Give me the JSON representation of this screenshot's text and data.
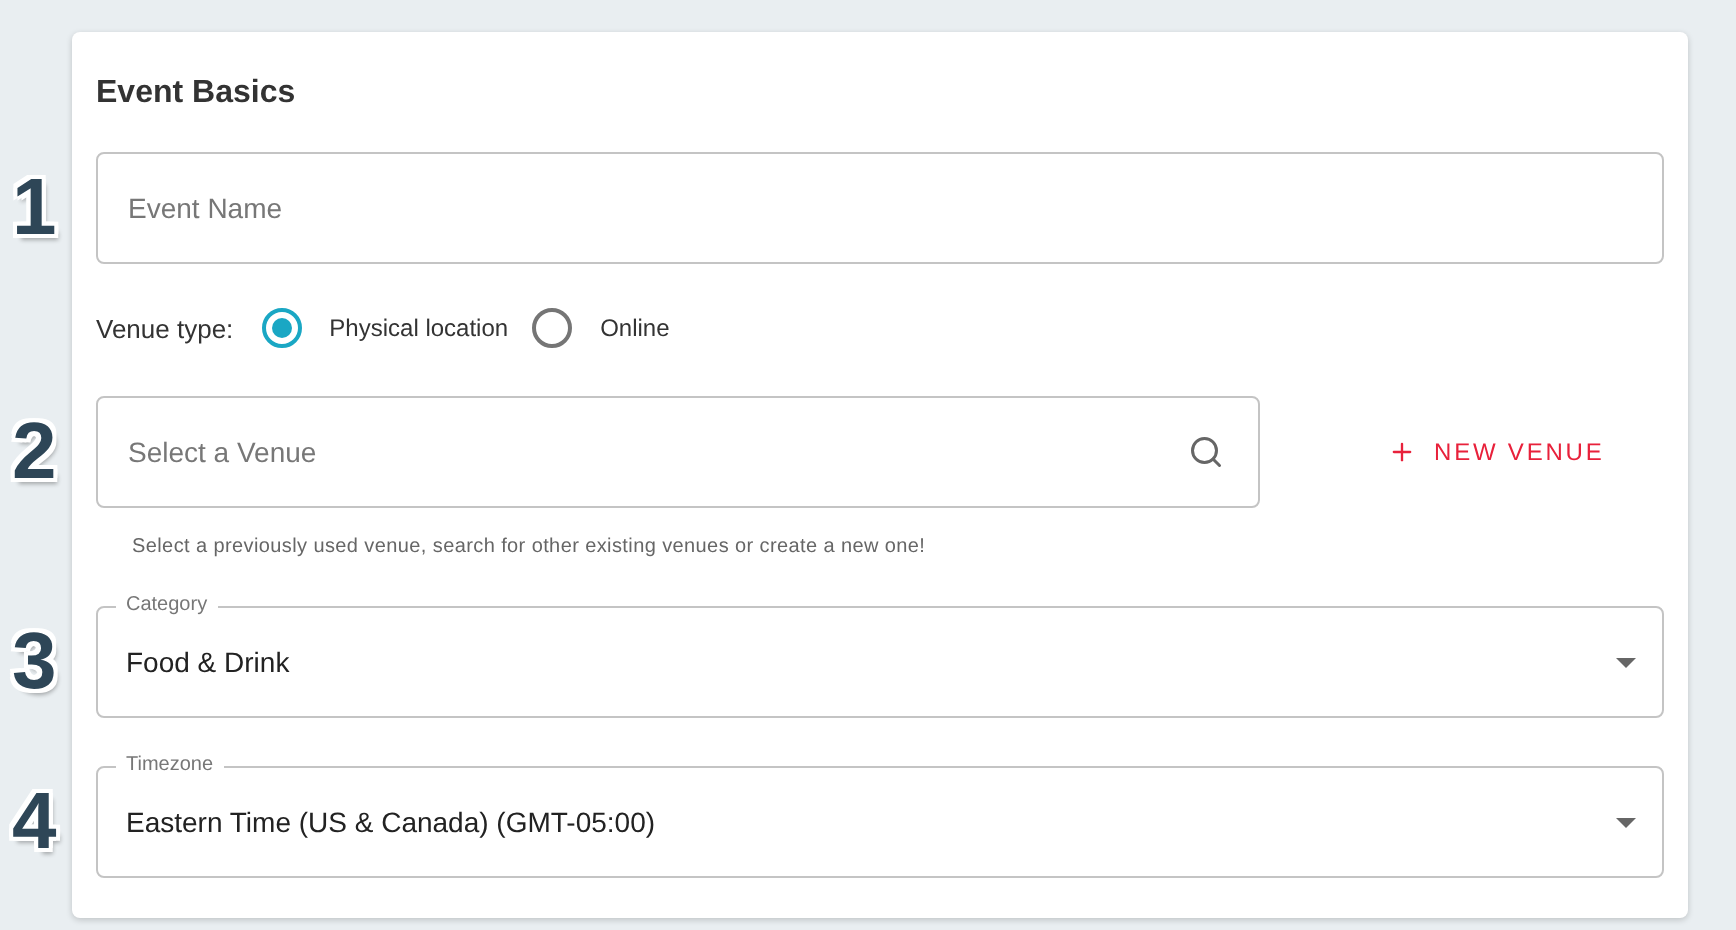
{
  "card": {
    "title": "Event Basics"
  },
  "event_name": {
    "step": "1",
    "placeholder": "Event Name"
  },
  "venue_type": {
    "label": "Venue type:",
    "options": [
      {
        "label": "Physical location",
        "selected": true
      },
      {
        "label": "Online",
        "selected": false
      }
    ]
  },
  "venue": {
    "step": "2",
    "placeholder": "Select a Venue",
    "button": "NEW VENUE",
    "helper": "Select a previously used venue, search for other existing venues or create a new one!"
  },
  "category": {
    "step": "3",
    "label": "Category",
    "value": "Food & Drink"
  },
  "timezone": {
    "step": "4",
    "label": "Timezone",
    "value": "Eastern Time (US & Canada) (GMT-05:00)"
  }
}
